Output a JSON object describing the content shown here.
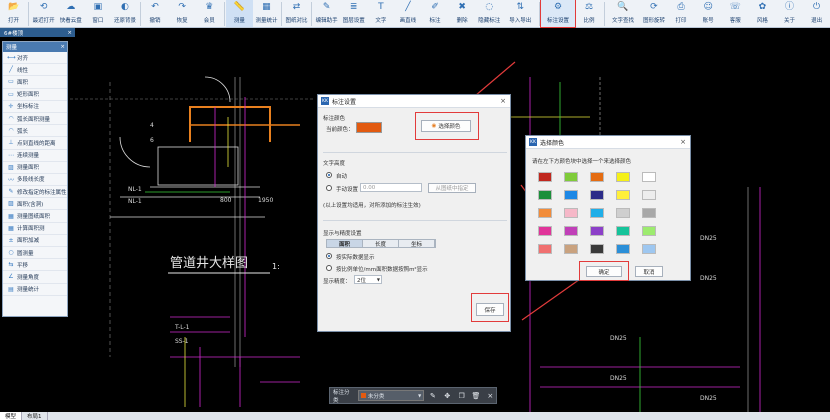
{
  "toolbar": {
    "items": [
      {
        "label": "打开",
        "icon": "folder-open-icon"
      },
      {
        "label": "最近打开",
        "icon": "recent-icon"
      },
      {
        "label": "快看云盘",
        "icon": "cloud-icon"
      },
      {
        "label": "窗口",
        "icon": "window-icon"
      },
      {
        "label": "还原背景",
        "icon": "background-icon"
      },
      {
        "label": "撤销",
        "icon": "undo-icon"
      },
      {
        "label": "恢复",
        "icon": "redo-icon"
      },
      {
        "label": "会员",
        "icon": "vip-icon"
      },
      {
        "label": "测量",
        "icon": "measure-icon"
      },
      {
        "label": "测量统计",
        "icon": "stats-icon"
      },
      {
        "label": "图纸对比",
        "icon": "compare-icon"
      },
      {
        "label": "编辑助手",
        "icon": "edit-helper-icon"
      },
      {
        "label": "图层设置",
        "icon": "layers-icon"
      },
      {
        "label": "文字",
        "icon": "text-icon"
      },
      {
        "label": "画直线",
        "icon": "line-icon"
      },
      {
        "label": "标注",
        "icon": "annotate-icon"
      },
      {
        "label": "删除",
        "icon": "delete-icon"
      },
      {
        "label": "隐藏标注",
        "icon": "hide-icon"
      },
      {
        "label": "导入导出",
        "icon": "import-export-icon"
      },
      {
        "label": "标注设置",
        "icon": "annotation-settings-icon"
      },
      {
        "label": "比例",
        "icon": "scale-icon"
      },
      {
        "label": "文字查找",
        "icon": "text-search-icon"
      },
      {
        "label": "图形旋转",
        "icon": "rotate-icon"
      },
      {
        "label": "打印",
        "icon": "print-icon"
      },
      {
        "label": "账号",
        "icon": "account-icon"
      },
      {
        "label": "客服",
        "icon": "support-icon"
      },
      {
        "label": "风格",
        "icon": "theme-icon"
      },
      {
        "label": "关于",
        "icon": "about-icon"
      },
      {
        "label": "退出",
        "icon": "exit-icon"
      }
    ]
  },
  "doc_tab": {
    "label": "6#楼顶",
    "close": "×"
  },
  "left_panel": {
    "title": "测量",
    "close": "×",
    "items": [
      "对齐",
      "线性",
      "面积",
      "矩形面积",
      "坐标标注",
      "弧长面积测量",
      "弧长",
      "点到直线的距离",
      "连续测量",
      "测量面积",
      "多段线长度",
      "修改指定的标注属性",
      "面积(含洞)",
      "测量图纸面积",
      "计算面积测",
      "面积加减",
      "圆测量",
      "平移",
      "测量角度",
      "测量统计"
    ]
  },
  "dialog_annotation": {
    "title": "标注设置",
    "close": "×",
    "section_color": "标注颜色",
    "current_color_label": "当前颜色：",
    "current_color": "#E25A10",
    "choose_color_button": "选择颜色",
    "section_text_height": "文字高度",
    "auto_label": "自动",
    "manual_label": "手动设置",
    "manual_value": "0.00",
    "pick_from_drawing": "从图纸中指定",
    "note": "(以上设置均适用，对所添加的标注生效)",
    "section_display": "显示与精度设置",
    "tabs": [
      "面积",
      "长度",
      "坐标"
    ],
    "opt1": "按实际数据显示",
    "opt2": "按比例单位/mm面积数据按照m²显示",
    "precision_label": "显示精度：",
    "precision_value": "2位",
    "save_button": "保存"
  },
  "dialog_color": {
    "title": "选择颜色",
    "close": "×",
    "prompt": "请在左下方颜色块中选择一个来选择颜色",
    "colors": [
      "#C0271E",
      "#7FCB3A",
      "#E46C12",
      "#F5F018",
      "#FFFFFF",
      "#1B8F3A",
      "#1E88E5",
      "#2C2C88",
      "#FFEF3A",
      "#EDEDED",
      "#F18C3A",
      "#F6B8C8",
      "#1FAEE8",
      "#CFCFCF",
      "#A8A8A8",
      "#E0349A",
      "#C040B8",
      "#8C40C8",
      "#16C39A",
      "#9DEB6F",
      "#F07070",
      "#C9A27F",
      "#3A3A3A",
      "#2B8FD8",
      "#9EC7F0"
    ],
    "ok_button": "确定",
    "cancel_button": "取消"
  },
  "annotation_bar": {
    "label": "标注分类",
    "category": "未分类"
  },
  "bottom_tabs": [
    "模型",
    "布局1"
  ],
  "drawing": {
    "title": "管道井大样图",
    "scale": "1:",
    "labels_left": [
      "NL-1",
      "NL-1",
      "T-L-1",
      "SS-1",
      "800",
      "1950",
      "4",
      "6"
    ],
    "labels_right": [
      "DN25",
      "DN25",
      "DN25",
      "DN25",
      "DN25"
    ]
  }
}
